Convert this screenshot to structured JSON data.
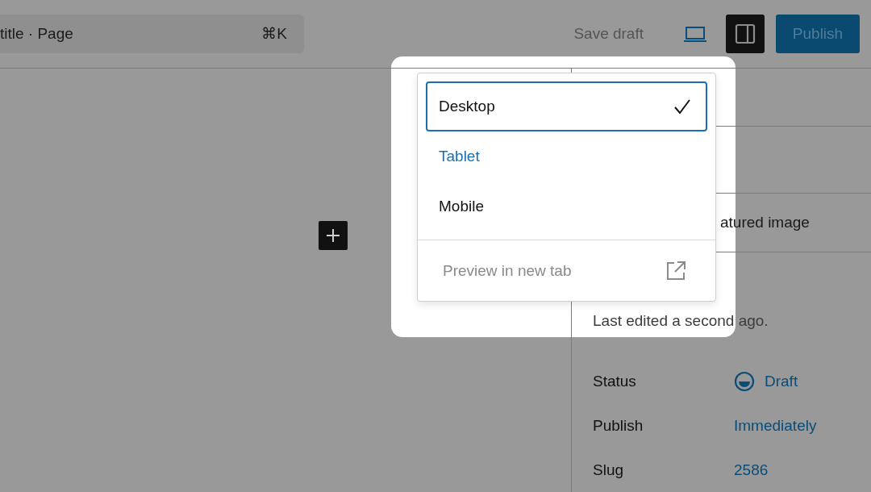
{
  "command_bar": {
    "title": "title · Page",
    "shortcut": "⌘K"
  },
  "header": {
    "save_draft": "Save draft",
    "settings_open": true,
    "publish": "Publish"
  },
  "preview_menu": {
    "items": [
      {
        "label": "Desktop",
        "selected": true,
        "highlighted": false
      },
      {
        "label": "Tablet",
        "selected": false,
        "highlighted": true
      },
      {
        "label": "Mobile",
        "selected": false,
        "highlighted": false
      }
    ],
    "preview_link": {
      "label": "Preview in new tab",
      "disabled": true
    }
  },
  "sidebar": {
    "featured_image": "atured image",
    "last_edited": "Last edited a second ago.",
    "fields": [
      {
        "label": "Status",
        "value": "Draft",
        "kind": "status"
      },
      {
        "label": "Publish",
        "value": "Immediately",
        "kind": "link"
      },
      {
        "label": "Slug",
        "value": "2586",
        "kind": "link"
      }
    ]
  }
}
